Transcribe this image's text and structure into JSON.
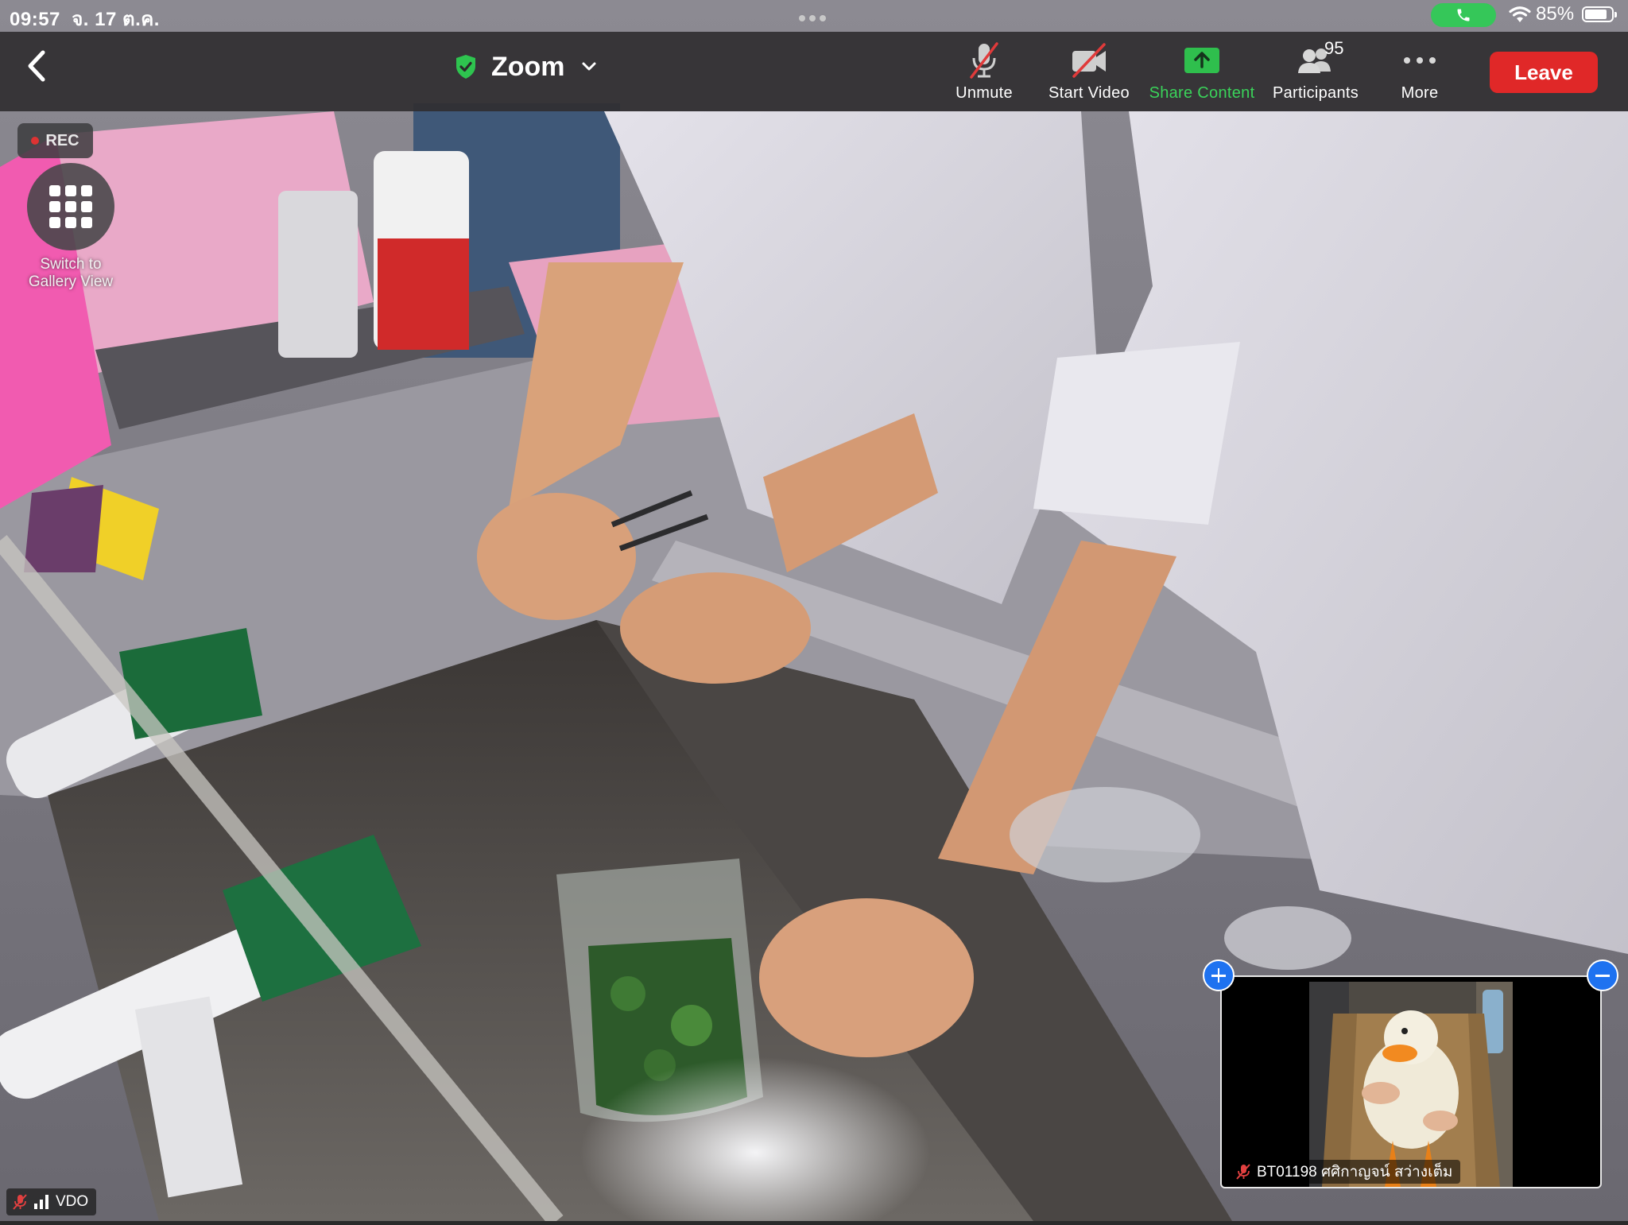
{
  "status_bar": {
    "time": "09:57",
    "date": "จ. 17 ต.ค.",
    "battery_percent": "85%",
    "battery_level": 0.85,
    "call_color": "#35c759"
  },
  "toolbar": {
    "back_icon": "chevron-left-icon",
    "meeting_title": "Zoom",
    "shield_color": "#2ec44f",
    "unmute_label": "Unmute",
    "start_video_label": "Start Video",
    "share_content_label": "Share Content",
    "share_color": "#3ad35a",
    "participants_label": "Participants",
    "participants_count": "95",
    "more_label": "More",
    "leave_label": "Leave",
    "leave_color": "#e02828"
  },
  "overlays": {
    "rec_label": "REC",
    "gallery_label": "Switch to\nGallery View"
  },
  "self_view": {
    "name": "BT01198 ศศิกาญจน์ สว่างเต็ม",
    "muted": true
  },
  "speaker_tag": {
    "label": "VDO",
    "muted": true
  }
}
